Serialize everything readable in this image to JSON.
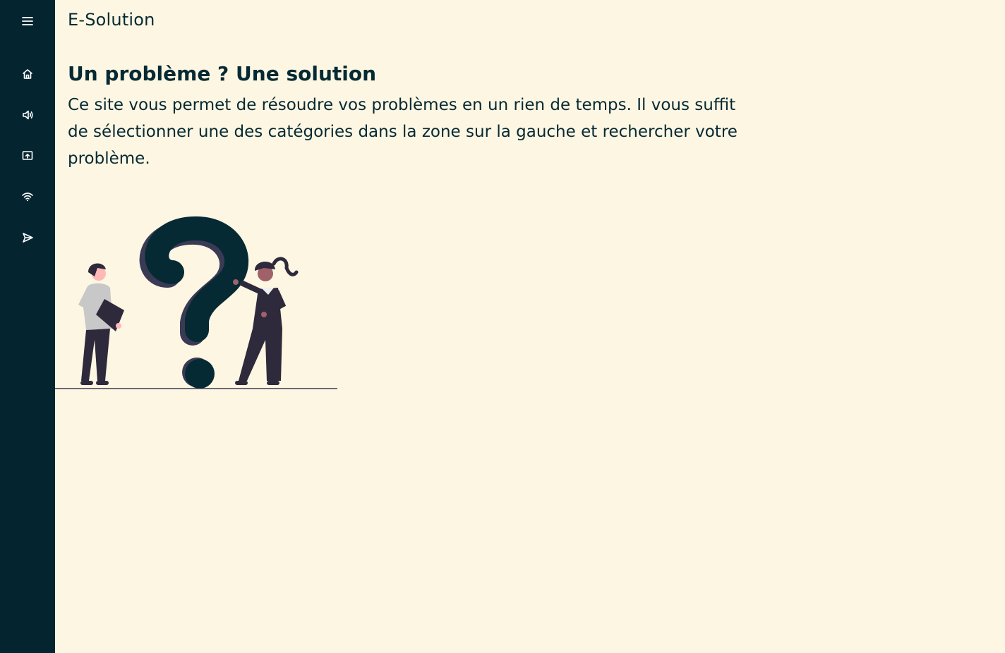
{
  "app": {
    "title": "E-Solution"
  },
  "sidebar": {
    "items": [
      {
        "icon": "menu-icon"
      },
      {
        "icon": "home-icon"
      },
      {
        "icon": "speaker-icon"
      },
      {
        "icon": "screen-share-icon"
      },
      {
        "icon": "wifi-icon"
      },
      {
        "icon": "send-icon"
      }
    ]
  },
  "main": {
    "headline": "Un problème ? Une solution",
    "intro": "Ce site vous permet de résoudre vos problèmes en un rien de temps. Il vous suffit de sélectionner une des catégories dans la zone sur la gauche et rechercher votre problème."
  },
  "colors": {
    "sidebar": "#042530",
    "background": "#fdf6e3",
    "text": "#062a33",
    "question_mark": "#062a33",
    "figure_dark": "#2e2a3c",
    "skin": "#ffb8b8"
  }
}
